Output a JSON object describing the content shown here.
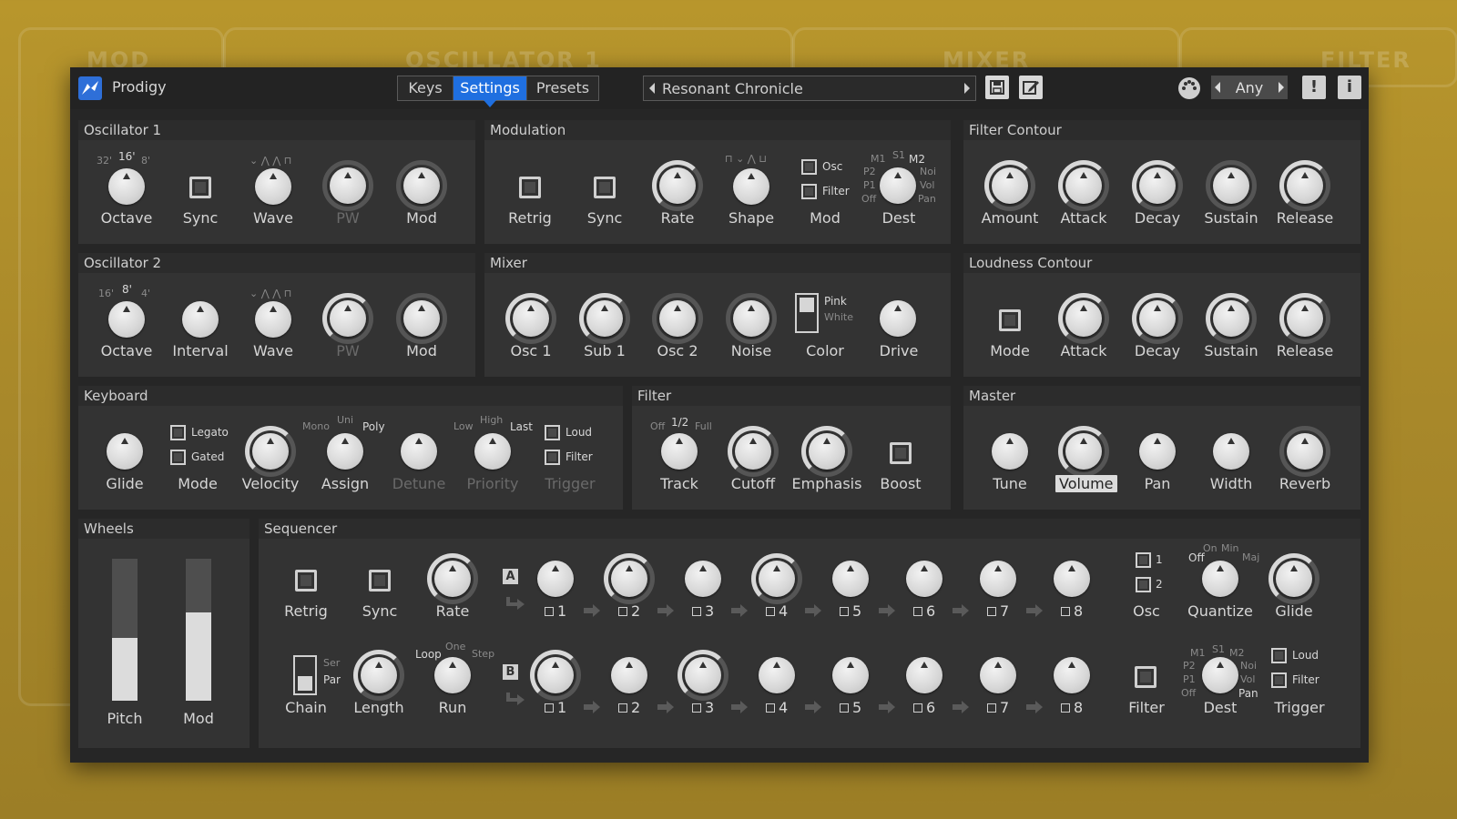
{
  "background": {
    "words": [
      "MOD",
      "OSCILLATOR 1",
      "MIXER",
      "FILTER"
    ]
  },
  "titlebar": {
    "app_name": "Prodigy",
    "tabs": [
      "Keys",
      "Settings",
      "Presets"
    ],
    "active_tab": "Settings",
    "preset_name": "Resonant Chronicle",
    "voice_mode": "Any"
  },
  "osc1": {
    "title": "Oscillator 1",
    "octave_opts": [
      "32'",
      "16'",
      "8'"
    ],
    "labels": [
      "Octave",
      "Sync",
      "Wave",
      "PW",
      "Mod"
    ]
  },
  "osc2": {
    "title": "Oscillator 2",
    "octave_opts": [
      "16'",
      "8'",
      "4'"
    ],
    "labels": [
      "Octave",
      "Interval",
      "Wave",
      "PW",
      "Mod"
    ]
  },
  "modulation": {
    "title": "Modulation",
    "labels": [
      "Retrig",
      "Sync",
      "Rate",
      "Shape",
      "Mod",
      "Dest"
    ],
    "mod_opts": [
      "Osc",
      "Filter"
    ],
    "dest_opts": [
      "M1",
      "S1",
      "M2",
      "P2",
      "Noi",
      "P1",
      "Vol",
      "Off",
      "Pan"
    ]
  },
  "mixer": {
    "title": "Mixer",
    "labels": [
      "Osc 1",
      "Sub 1",
      "Osc 2",
      "Noise",
      "Color",
      "Drive"
    ],
    "color_opts": [
      "Pink",
      "White"
    ]
  },
  "filter_contour": {
    "title": "Filter Contour",
    "labels": [
      "Amount",
      "Attack",
      "Decay",
      "Sustain",
      "Release"
    ]
  },
  "loudness_contour": {
    "title": "Loudness Contour",
    "labels": [
      "Mode",
      "Attack",
      "Decay",
      "Sustain",
      "Release"
    ]
  },
  "keyboard": {
    "title": "Keyboard",
    "labels": [
      "Glide",
      "Mode",
      "Velocity",
      "Assign",
      "Detune",
      "Priority",
      "Trigger"
    ],
    "mode_opts": [
      "Legato",
      "Gated"
    ],
    "assign_opts": [
      "Mono",
      "Uni",
      "Poly"
    ],
    "priority_opts": [
      "Low",
      "High",
      "Last"
    ],
    "trigger_opts": [
      "Loud",
      "Filter"
    ]
  },
  "filter": {
    "title": "Filter",
    "labels": [
      "Track",
      "Cutoff",
      "Emphasis",
      "Boost"
    ],
    "track_opts": [
      "Off",
      "1/2",
      "Full"
    ]
  },
  "master": {
    "title": "Master",
    "labels": [
      "Tune",
      "Volume",
      "Pan",
      "Width",
      "Reverb"
    ]
  },
  "wheels": {
    "title": "Wheels",
    "labels": [
      "Pitch",
      "Mod"
    ],
    "pitch_level": 0.44,
    "mod_level": 0.62
  },
  "sequencer": {
    "title": "Sequencer",
    "row_a_letter": "A",
    "row_b_letter": "B",
    "steps": [
      "1",
      "2",
      "3",
      "4",
      "5",
      "6",
      "7",
      "8"
    ],
    "labels_top": [
      "Retrig",
      "Sync",
      "Rate",
      "Osc",
      "Quantize",
      "Glide"
    ],
    "labels_bottom": [
      "Chain",
      "Length",
      "Run",
      "Filter",
      "Dest",
      "Trigger"
    ],
    "chain_opts": [
      "Ser",
      "Par"
    ],
    "run_opts": [
      "Loop",
      "One",
      "Step"
    ],
    "osc_opts": [
      "1",
      "2"
    ],
    "quantize_opts": [
      "Off",
      "On",
      "Min",
      "Maj"
    ],
    "dest_opts": [
      "M1",
      "S1",
      "M2",
      "P2",
      "Noi",
      "P1",
      "Vol",
      "Off",
      "Pan"
    ],
    "trigger_opts": [
      "Loud",
      "Filter"
    ]
  },
  "colors": {
    "accent": "#1f6fe0",
    "panel": "#333333",
    "knob": "#d8d8d8",
    "background": "#a8882a"
  }
}
